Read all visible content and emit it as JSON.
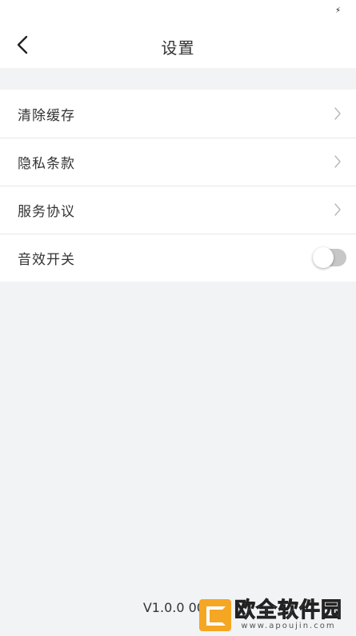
{
  "status_bar": {
    "icon": "bolt-icon"
  },
  "nav": {
    "back_icon": "chevron-left-icon",
    "title": "设置"
  },
  "settings": {
    "items": [
      {
        "label": "清除缓存",
        "type": "link"
      },
      {
        "label": "隐私条款",
        "type": "link"
      },
      {
        "label": "服务协议",
        "type": "link"
      },
      {
        "label": "音效开关",
        "type": "toggle",
        "on": false
      }
    ]
  },
  "footer": {
    "version": "V1.0.0 003"
  },
  "watermark": {
    "name": "欧全软件园",
    "url": "www.apoujin.com"
  },
  "colors": {
    "background": "#f2f3f5",
    "card": "#ffffff",
    "text": "#333333",
    "toggle_off": "#c7c7c7",
    "watermark_accent": "#f5a623"
  }
}
